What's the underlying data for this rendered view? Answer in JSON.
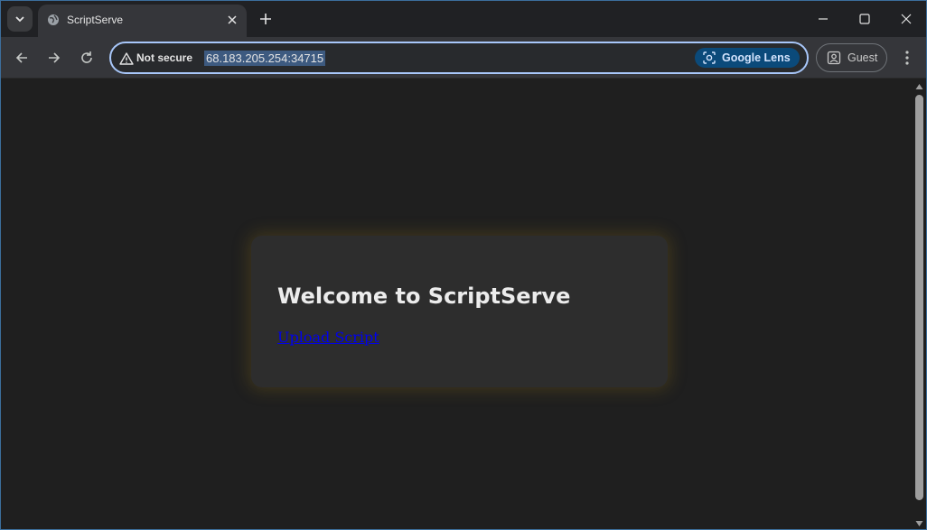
{
  "browser": {
    "tab": {
      "title": "ScriptServe",
      "favicon": "globe-icon"
    },
    "address": {
      "security_label": "Not secure",
      "url": "68.183.205.254:34715"
    },
    "lens_label": "Google Lens",
    "profile_label": "Guest"
  },
  "page": {
    "heading": "Welcome to ScriptServe",
    "link_label": "Upload Script"
  },
  "colors": {
    "accent": "#a8c7fa",
    "link": "#0000ee",
    "card_glow": "#96781a"
  }
}
